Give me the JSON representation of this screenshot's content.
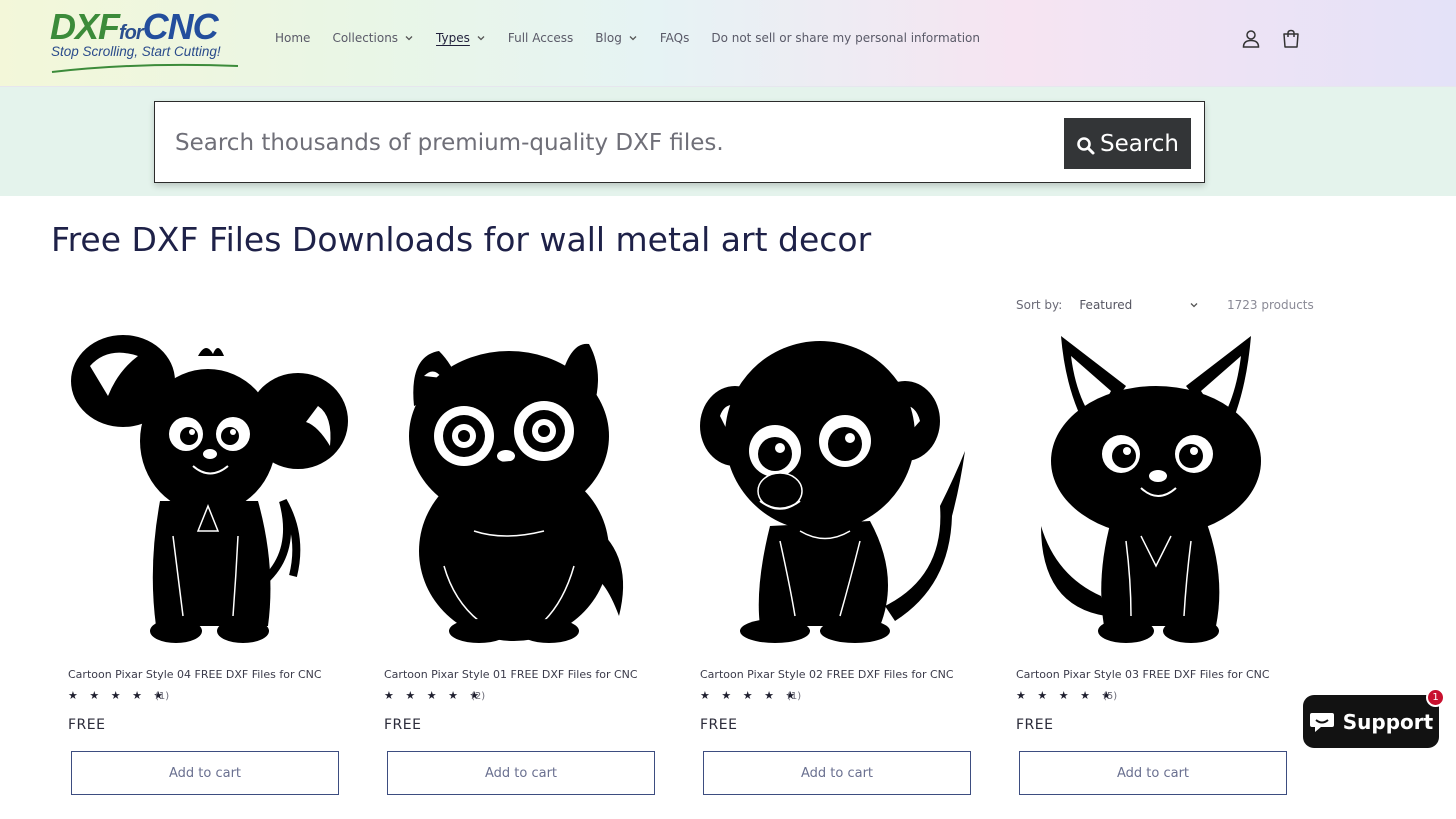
{
  "header": {
    "logo": {
      "word_dxf": "DXF",
      "word_for": "for",
      "word_cnc": "CNC",
      "tagline": "Stop Scrolling, Start Cutting!"
    },
    "nav": [
      {
        "label": "Home",
        "dropdown": false
      },
      {
        "label": "Collections",
        "dropdown": true
      },
      {
        "label": "Types",
        "dropdown": true,
        "active": true
      },
      {
        "label": "Full Access",
        "dropdown": false
      },
      {
        "label": "Blog",
        "dropdown": true
      },
      {
        "label": "FAQs",
        "dropdown": false
      },
      {
        "label": "Do not sell or share my personal information",
        "dropdown": false
      }
    ],
    "icons": [
      "account-icon",
      "cart-icon"
    ]
  },
  "search": {
    "placeholder": "Search thousands of premium-quality DXF files.",
    "button_label": "Search"
  },
  "page": {
    "title": "Free DXF Files Downloads for wall metal art decor"
  },
  "toolbar": {
    "sort_label": "Sort by:",
    "sort_value": "Featured",
    "product_count": "1723 products"
  },
  "products": [
    {
      "title": "Cartoon Pixar Style 04 FREE DXF Files for CNC",
      "rating": "★ ★ ★ ★ ★",
      "reviews": "(1)",
      "price": "FREE",
      "button": "Add to cart",
      "image": "cartoon-mouse-silhouette"
    },
    {
      "title": "Cartoon Pixar Style 01 FREE DXF Files for CNC",
      "rating": "★ ★ ★ ★ ★",
      "reviews": "(2)",
      "price": "FREE",
      "button": "Add to cart",
      "image": "cartoon-owl-cat-silhouette"
    },
    {
      "title": "Cartoon Pixar Style 02 FREE DXF Files for CNC",
      "rating": "★ ★ ★ ★ ★",
      "reviews": "(1)",
      "price": "FREE",
      "button": "Add to cart",
      "image": "cartoon-monkey-silhouette"
    },
    {
      "title": "Cartoon Pixar Style 03 FREE DXF Files for CNC",
      "rating": "★ ★ ★ ★ ★",
      "reviews": "(5)",
      "price": "FREE",
      "button": "Add to cart",
      "image": "cartoon-cat-silhouette"
    }
  ],
  "support": {
    "label": "Support",
    "badge": "1"
  },
  "colors": {
    "brand_green": "#3c8b3a",
    "brand_blue": "#234e9d",
    "title_navy": "#1e2148",
    "search_button": "#333537",
    "badge_red": "#c8102e"
  }
}
